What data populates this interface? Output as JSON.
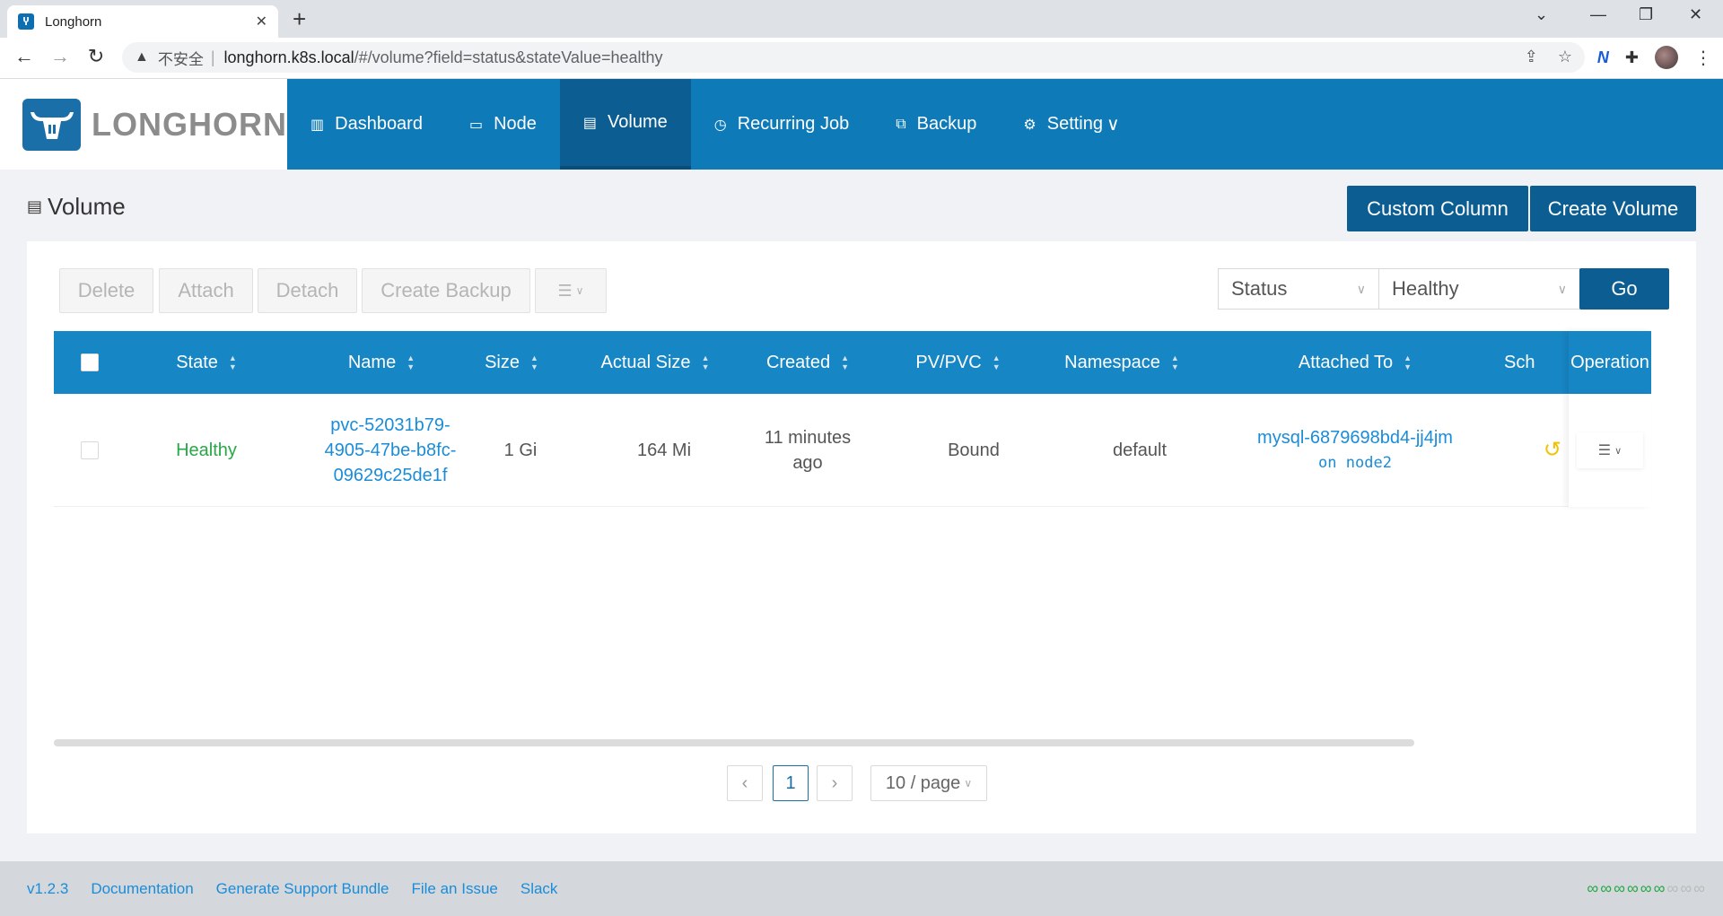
{
  "browser": {
    "tab_title": "Longhorn",
    "insecure_label": "不安全",
    "url_host": "longhorn.k8s.local",
    "url_rest": "/#/volume?field=status&stateValue=healthy"
  },
  "brand": {
    "name": "LONGHORN"
  },
  "menu": [
    {
      "label": "Dashboard",
      "icon": "bar-chart-icon"
    },
    {
      "label": "Node",
      "icon": "laptop-icon"
    },
    {
      "label": "Volume",
      "icon": "database-icon",
      "active": true
    },
    {
      "label": "Recurring Job",
      "icon": "clock-icon"
    },
    {
      "label": "Backup",
      "icon": "copy-icon"
    },
    {
      "label": "Setting",
      "icon": "gear-icon"
    }
  ],
  "page": {
    "title": "Volume",
    "custom_column": "Custom Column",
    "create_volume": "Create Volume"
  },
  "toolbar": {
    "delete": "Delete",
    "attach": "Attach",
    "detach": "Detach",
    "create_backup": "Create Backup"
  },
  "filter": {
    "field": "Status",
    "value": "Healthy",
    "go": "Go"
  },
  "table": {
    "columns": [
      "State",
      "Name",
      "Size",
      "Actual Size",
      "Created",
      "PV/PVC",
      "Namespace",
      "Attached To",
      "Sch",
      "Operation"
    ],
    "rows": [
      {
        "state": "Healthy",
        "name_line1": "pvc-52031b79-",
        "name_line2": "4905-47be-b8fc-",
        "name_line3": "09629c25de1f",
        "size": "1 Gi",
        "actual_size": "164 Mi",
        "created_line1": "11 minutes",
        "created_line2": "ago",
        "pv_pvc": "Bound",
        "namespace": "default",
        "attached_to": "mysql-6879698bd4-jj4jm",
        "attached_node": "on node2"
      }
    ]
  },
  "pagination": {
    "current_page": "1",
    "page_size": "10 / page"
  },
  "footer": {
    "version": "v1.2.3",
    "documentation": "Documentation",
    "support_bundle": "Generate Support Bundle",
    "file_issue": "File an Issue",
    "slack": "Slack",
    "connection_links_active": 6,
    "connection_links_total": 9
  },
  "colors": {
    "header_blue": "#0f7ab8",
    "active_menu": "#0c5d92",
    "table_head": "#1786c4",
    "healthy_green": "#27a844",
    "link_blue": "#1a8cd8"
  }
}
